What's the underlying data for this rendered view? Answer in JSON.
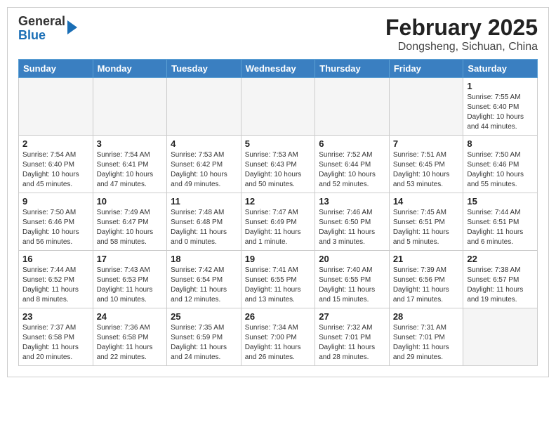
{
  "header": {
    "logo_general": "General",
    "logo_blue": "Blue",
    "month_title": "February 2025",
    "location": "Dongsheng, Sichuan, China"
  },
  "weekdays": [
    "Sunday",
    "Monday",
    "Tuesday",
    "Wednesday",
    "Thursday",
    "Friday",
    "Saturday"
  ],
  "weeks": [
    [
      {
        "day": "",
        "info": ""
      },
      {
        "day": "",
        "info": ""
      },
      {
        "day": "",
        "info": ""
      },
      {
        "day": "",
        "info": ""
      },
      {
        "day": "",
        "info": ""
      },
      {
        "day": "",
        "info": ""
      },
      {
        "day": "1",
        "info": "Sunrise: 7:55 AM\nSunset: 6:40 PM\nDaylight: 10 hours and 44 minutes."
      }
    ],
    [
      {
        "day": "2",
        "info": "Sunrise: 7:54 AM\nSunset: 6:40 PM\nDaylight: 10 hours and 45 minutes."
      },
      {
        "day": "3",
        "info": "Sunrise: 7:54 AM\nSunset: 6:41 PM\nDaylight: 10 hours and 47 minutes."
      },
      {
        "day": "4",
        "info": "Sunrise: 7:53 AM\nSunset: 6:42 PM\nDaylight: 10 hours and 49 minutes."
      },
      {
        "day": "5",
        "info": "Sunrise: 7:53 AM\nSunset: 6:43 PM\nDaylight: 10 hours and 50 minutes."
      },
      {
        "day": "6",
        "info": "Sunrise: 7:52 AM\nSunset: 6:44 PM\nDaylight: 10 hours and 52 minutes."
      },
      {
        "day": "7",
        "info": "Sunrise: 7:51 AM\nSunset: 6:45 PM\nDaylight: 10 hours and 53 minutes."
      },
      {
        "day": "8",
        "info": "Sunrise: 7:50 AM\nSunset: 6:46 PM\nDaylight: 10 hours and 55 minutes."
      }
    ],
    [
      {
        "day": "9",
        "info": "Sunrise: 7:50 AM\nSunset: 6:46 PM\nDaylight: 10 hours and 56 minutes."
      },
      {
        "day": "10",
        "info": "Sunrise: 7:49 AM\nSunset: 6:47 PM\nDaylight: 10 hours and 58 minutes."
      },
      {
        "day": "11",
        "info": "Sunrise: 7:48 AM\nSunset: 6:48 PM\nDaylight: 11 hours and 0 minutes."
      },
      {
        "day": "12",
        "info": "Sunrise: 7:47 AM\nSunset: 6:49 PM\nDaylight: 11 hours and 1 minute."
      },
      {
        "day": "13",
        "info": "Sunrise: 7:46 AM\nSunset: 6:50 PM\nDaylight: 11 hours and 3 minutes."
      },
      {
        "day": "14",
        "info": "Sunrise: 7:45 AM\nSunset: 6:51 PM\nDaylight: 11 hours and 5 minutes."
      },
      {
        "day": "15",
        "info": "Sunrise: 7:44 AM\nSunset: 6:51 PM\nDaylight: 11 hours and 6 minutes."
      }
    ],
    [
      {
        "day": "16",
        "info": "Sunrise: 7:44 AM\nSunset: 6:52 PM\nDaylight: 11 hours and 8 minutes."
      },
      {
        "day": "17",
        "info": "Sunrise: 7:43 AM\nSunset: 6:53 PM\nDaylight: 11 hours and 10 minutes."
      },
      {
        "day": "18",
        "info": "Sunrise: 7:42 AM\nSunset: 6:54 PM\nDaylight: 11 hours and 12 minutes."
      },
      {
        "day": "19",
        "info": "Sunrise: 7:41 AM\nSunset: 6:55 PM\nDaylight: 11 hours and 13 minutes."
      },
      {
        "day": "20",
        "info": "Sunrise: 7:40 AM\nSunset: 6:55 PM\nDaylight: 11 hours and 15 minutes."
      },
      {
        "day": "21",
        "info": "Sunrise: 7:39 AM\nSunset: 6:56 PM\nDaylight: 11 hours and 17 minutes."
      },
      {
        "day": "22",
        "info": "Sunrise: 7:38 AM\nSunset: 6:57 PM\nDaylight: 11 hours and 19 minutes."
      }
    ],
    [
      {
        "day": "23",
        "info": "Sunrise: 7:37 AM\nSunset: 6:58 PM\nDaylight: 11 hours and 20 minutes."
      },
      {
        "day": "24",
        "info": "Sunrise: 7:36 AM\nSunset: 6:58 PM\nDaylight: 11 hours and 22 minutes."
      },
      {
        "day": "25",
        "info": "Sunrise: 7:35 AM\nSunset: 6:59 PM\nDaylight: 11 hours and 24 minutes."
      },
      {
        "day": "26",
        "info": "Sunrise: 7:34 AM\nSunset: 7:00 PM\nDaylight: 11 hours and 26 minutes."
      },
      {
        "day": "27",
        "info": "Sunrise: 7:32 AM\nSunset: 7:01 PM\nDaylight: 11 hours and 28 minutes."
      },
      {
        "day": "28",
        "info": "Sunrise: 7:31 AM\nSunset: 7:01 PM\nDaylight: 11 hours and 29 minutes."
      },
      {
        "day": "",
        "info": ""
      }
    ]
  ]
}
